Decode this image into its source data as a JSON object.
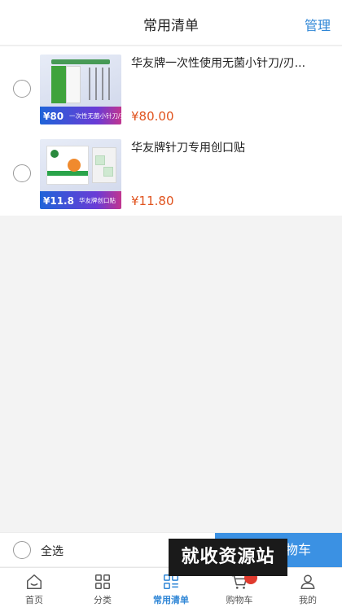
{
  "header": {
    "title": "常用清单",
    "manage_label": "管理"
  },
  "items": [
    {
      "name": "华友牌一次性使用无菌小针刀/刃...",
      "price": "¥80.00",
      "thumb": {
        "price_tag": "¥80",
        "caption": "一次性无菌小针刀/刃针"
      }
    },
    {
      "name": "华友牌针刀专用创口贴",
      "price": "¥11.80",
      "thumb": {
        "price_tag": "¥11.8",
        "caption": "华友牌创口贴"
      }
    }
  ],
  "bottom_bar": {
    "select_all_label": "全选",
    "add_to_cart_label": "加入购物车"
  },
  "watermark": "就收资源站",
  "tabbar": [
    {
      "label": "首页",
      "icon": "home-icon",
      "active": false
    },
    {
      "label": "分类",
      "icon": "grid-icon",
      "active": false
    },
    {
      "label": "常用清单",
      "icon": "list-icon",
      "active": true
    },
    {
      "label": "购物车",
      "icon": "cart-icon",
      "active": false
    },
    {
      "label": "我的",
      "icon": "user-icon",
      "active": false
    }
  ],
  "colors": {
    "accent": "#2f86d6",
    "price": "#e0531e",
    "button": "#3b91e3",
    "badge": "#e03a2e"
  }
}
